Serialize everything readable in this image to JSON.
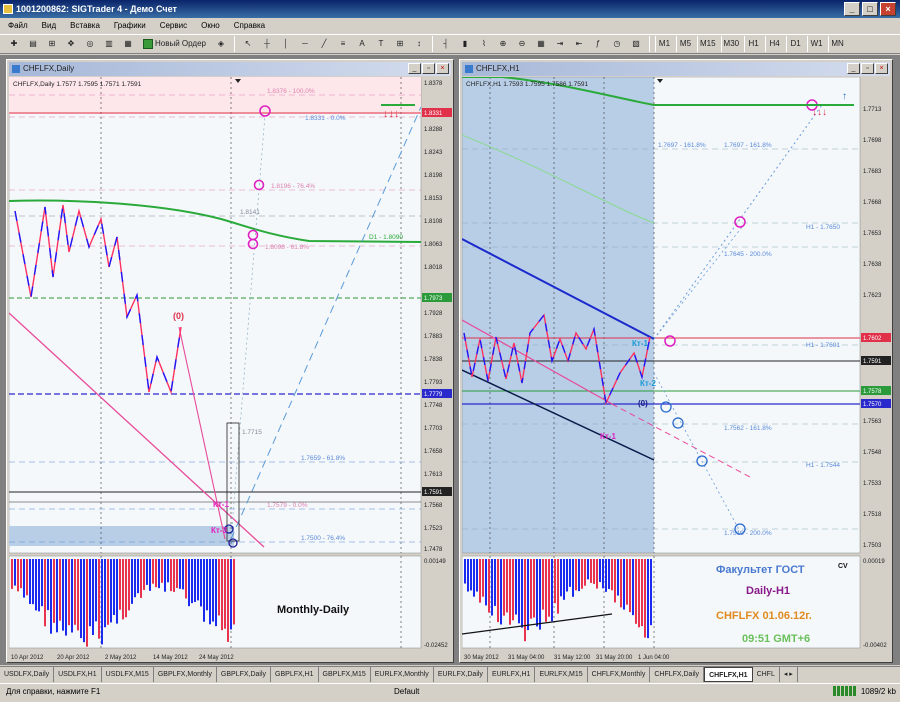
{
  "app": {
    "title": "1001200862: SIGTrader 4 - Демо Счет"
  },
  "menu": [
    "Файл",
    "Вид",
    "Вставка",
    "Графики",
    "Сервис",
    "Окно",
    "Справка"
  ],
  "toolbar": {
    "new_order_label": "Новый Ордер",
    "text_tool": "A",
    "timeframes": [
      "M1",
      "M5",
      "M15",
      "M30",
      "H1",
      "H4",
      "D1",
      "W1",
      "MN"
    ]
  },
  "left_chart": {
    "window_title": "CHFLFX,Daily",
    "info": "CHFLFX,Daily  1.7577 1.7595 1.7571 1.7591",
    "price_ticks": [
      "1.8378",
      "1.8331",
      "1.8288",
      "1.8243",
      "1.8198",
      "1.8153",
      "1.8108",
      "1.8063",
      "1.8018",
      "1.7973",
      "1.7928",
      "1.7883",
      "1.7838",
      "1.7793",
      "1.7748",
      "1.7703",
      "1.7658",
      "1.7613",
      "1.7568",
      "1.7523",
      "1.7478"
    ],
    "highlight_prices": {
      "red": "1.8331",
      "green": "1.7973",
      "blue": "1.7779",
      "black": "1.7591"
    },
    "fib_labels": [
      "1.8376 - 100.0%",
      "1.8331 - 0.0%",
      "1.8196 - 76.4%",
      "1.8141",
      "1.8098 - 61.8%",
      "D1 - 1.8090",
      "1.7715",
      "1.7659 - 61.8%",
      "1.7579 - 0.0%",
      "1.7500 - 76.4%"
    ],
    "wave_labels": [
      "(0)",
      "Кт-1",
      "Кт-3"
    ],
    "dates": [
      "10 Apr 2012",
      "20 Apr 2012",
      "2 May 2012",
      "14 May 2012",
      "24 May 2012"
    ],
    "osc_ticks": [
      "0.00149",
      "-0.02452"
    ],
    "osc_title": "Monthly-Daily"
  },
  "right_chart": {
    "window_title": "CHFLFX,H1",
    "info": "CHFLFX,H1  1.7593 1.7595 1.7586 1.7591",
    "price_ticks": [
      "1.7713",
      "1.7698",
      "1.7683",
      "1.7668",
      "1.7653",
      "1.7638",
      "1.7623",
      "1.7608",
      "1.7593",
      "1.7578",
      "1.7563",
      "1.7548",
      "1.7533",
      "1.7518",
      "1.7503"
    ],
    "highlight_prices": {
      "red": "1.7602",
      "black": "1.7591",
      "green": "1.7578",
      "blue": "1.7570"
    },
    "fib_labels": [
      "1.7697 - 161.8%",
      "1.7697 - 161.8%",
      "H1 - 1.7650",
      "1.7645 - 200.0%",
      "H1 - 1.7601",
      "1.7562 - 161.8%",
      "H1 - 1.7544",
      "1.7513 - 200.0%"
    ],
    "wave_labels": [
      "Кт-1",
      "Кт-2",
      "(0)",
      "Кт-1"
    ],
    "dates": [
      "30 May 2012",
      "31 May 04:00",
      "31 May 12:00",
      "31 May 20:00",
      "1 Jun 04:00"
    ],
    "osc_ticks": [
      "0.00019",
      "-0.00402"
    ],
    "overlay": {
      "line1": "Факультет ГОСТ",
      "line1_sup": "CV",
      "line2": "Daily-H1",
      "line3": "CHFLFX  01.06.12г.",
      "line4": "09:51 GMT+6"
    }
  },
  "tabs": [
    "USDLFX,Daily",
    "USDLFX,H1",
    "USDLFX,M15",
    "GBPLFX,Monthly",
    "GBPLFX,Daily",
    "GBPLFX,H1",
    "GBPLFX,M15",
    "EURLFX,Monthly",
    "EURLFX,Daily",
    "EURLFX,H1",
    "EURLFX,M15",
    "CHFLFX,Monthly",
    "CHFLFX,Daily",
    "CHFLFX,H1",
    "CHFL"
  ],
  "active_tab_index": 13,
  "status": {
    "help": "Для справки, нажмите F1",
    "profile": "Default",
    "traffic": "1089/2 kb"
  },
  "colors": {
    "bg_chart": "#f4f8fb",
    "bull": "#1a1aff",
    "bear": "#ff3060",
    "fib": "#5a8ad8",
    "magenta": "#e020c0"
  }
}
